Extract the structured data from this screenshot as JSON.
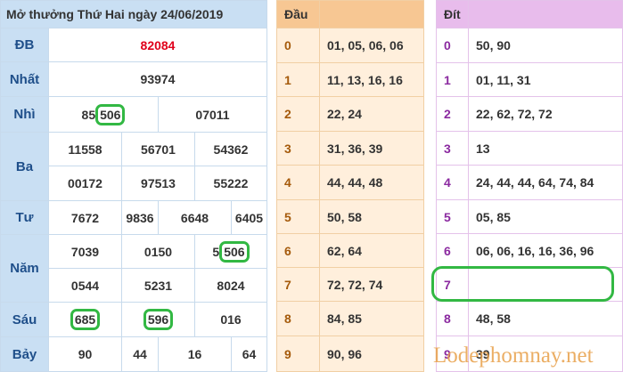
{
  "title": "Mở thưởng Thứ Hai ngày 24/06/2019",
  "prizes": {
    "db": {
      "label": "ĐB",
      "values": [
        "82084"
      ]
    },
    "nhat": {
      "label": "Nhất",
      "values": [
        "93974"
      ]
    },
    "nhi": {
      "label": "Nhì",
      "values": [
        "85506",
        "07011"
      ]
    },
    "ba": {
      "label": "Ba",
      "values": [
        "11558",
        "56701",
        "54362",
        "00172",
        "97513",
        "55222"
      ]
    },
    "tu": {
      "label": "Tư",
      "values": [
        "7672",
        "9836",
        "6648",
        "6405"
      ]
    },
    "nam": {
      "label": "Năm",
      "values": [
        "7039",
        "0150",
        "5506",
        "0544",
        "5231",
        "8024"
      ]
    },
    "sau": {
      "label": "Sáu",
      "values": [
        "685",
        "596",
        "016"
      ]
    },
    "bay": {
      "label": "Bảy",
      "values": [
        "90",
        "44",
        "16",
        "64"
      ]
    }
  },
  "dau": {
    "header": "Đầu",
    "rows": [
      {
        "k": "0",
        "v": "01, 05, 06, 06"
      },
      {
        "k": "1",
        "v": "11, 13, 16, 16"
      },
      {
        "k": "2",
        "v": "22, 24"
      },
      {
        "k": "3",
        "v": "31, 36, 39"
      },
      {
        "k": "4",
        "v": "44, 44, 48"
      },
      {
        "k": "5",
        "v": "50, 58"
      },
      {
        "k": "6",
        "v": "62, 64"
      },
      {
        "k": "7",
        "v": "72, 72, 74"
      },
      {
        "k": "8",
        "v": "84, 85"
      },
      {
        "k": "9",
        "v": "90, 96"
      }
    ]
  },
  "dit": {
    "header": "Đít",
    "rows": [
      {
        "k": "0",
        "v": "50, 90"
      },
      {
        "k": "1",
        "v": "01, 11, 31"
      },
      {
        "k": "2",
        "v": "22, 62, 72, 72"
      },
      {
        "k": "3",
        "v": "13"
      },
      {
        "k": "4",
        "v": "24, 44, 44, 64, 74, 84"
      },
      {
        "k": "5",
        "v": "05, 85"
      },
      {
        "k": "6",
        "v": "06, 06, 16, 16, 36, 96"
      },
      {
        "k": "7",
        "v": ""
      },
      {
        "k": "8",
        "v": "48, 58"
      },
      {
        "k": "9",
        "v": "39"
      }
    ]
  },
  "watermark": "Lodephomnay.net",
  "colors": {
    "highlight": "#32b843",
    "special": "#e0001b",
    "watermark": "#e8a04a"
  }
}
